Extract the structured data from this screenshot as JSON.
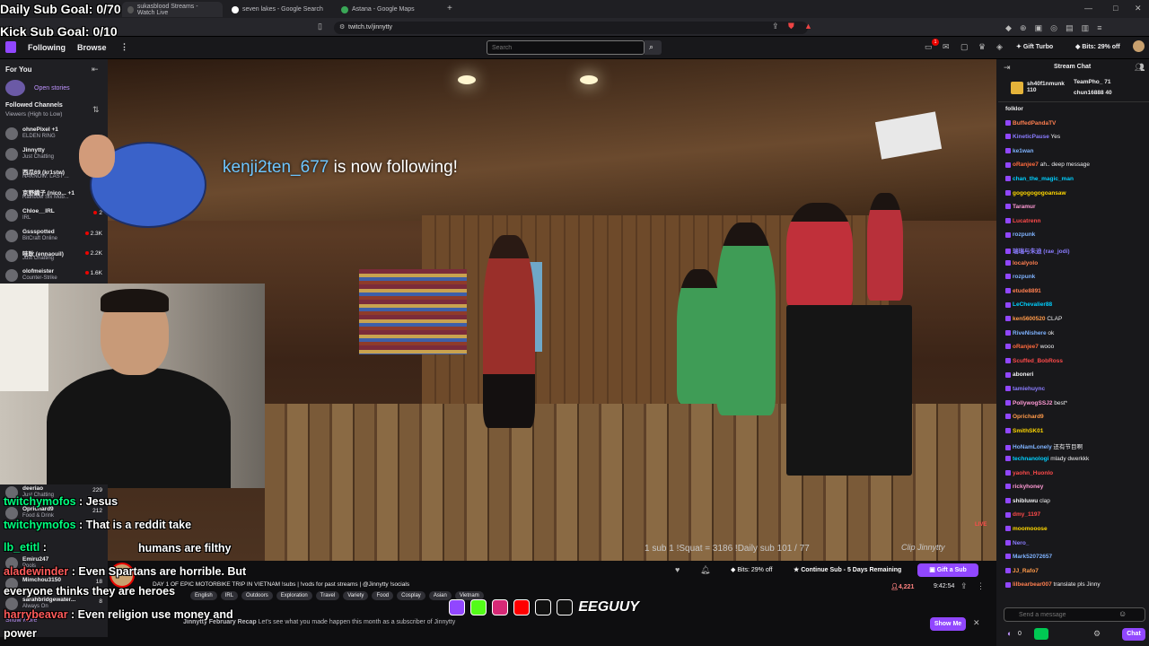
{
  "browser": {
    "tabs": [
      {
        "title": "sukasblood Streams - Watch Live"
      },
      {
        "title": "seven lakes - Google Search"
      },
      {
        "title": "Astana - Google Maps"
      }
    ],
    "new_tab": "+",
    "url": "twitch.tv/jinnytty"
  },
  "header": {
    "following": "Following",
    "browse": "Browse",
    "more": "⋮",
    "search_placeholder": "Search",
    "notif_count": "1",
    "get_turbo": "Gift Turbo",
    "bits": "Bits: 29% off"
  },
  "sidebar": {
    "for_you": "For You",
    "open_stories": "Open stories",
    "followed": "Followed Channels",
    "sort": "Viewers (High to Low)",
    "channels": [
      {
        "name": "ohnePixel +1",
        "game": "ELDEN RING",
        "viewers": ""
      },
      {
        "name": "Jinnytty",
        "game": "Just Chatting",
        "viewers": ""
      },
      {
        "name": "西瓜69 (kr1stw)",
        "game": "NAKNOW: LAST ...",
        "viewers": ""
      },
      {
        "name": "京野織子 (nico... +1",
        "game": "Rainbow Six Mob...",
        "viewers": ""
      },
      {
        "name": "Chloe__IRL",
        "game": "IRL",
        "viewers": "2"
      },
      {
        "name": "Gssspotted",
        "game": "BitCraft Online",
        "viewers": "2.3K"
      },
      {
        "name": "哇耿 (ennaouil)",
        "game": "Just Chatting",
        "viewers": "2.2K"
      },
      {
        "name": "olofmeister",
        "game": "Counter-Strike",
        "viewers": "1.6K"
      }
    ],
    "lower_channels": [
      {
        "name": "deeriao",
        "game": "Just Chatting",
        "viewers": "229"
      },
      {
        "name": "Oprichard9",
        "game": "Food & Drink",
        "viewers": "212"
      },
      {
        "name": "Emiru247",
        "game": "Pools",
        "viewers": ""
      },
      {
        "name": "Mimchou3150",
        "game": "",
        "viewers": "18"
      },
      {
        "name": "sarahbridgewater...",
        "game": "Always On",
        "viewers": "8"
      }
    ],
    "show_more": "Show More"
  },
  "overlay": {
    "goal1": "Daily Sub Goal: 0/70",
    "goal2": "Kick Sub Goal: 0/10",
    "follow_user": "kenji2ten_677",
    "follow_text": " is now following!",
    "sub_stats": "1 sub 1 !Squat = 3186  !Daily sub 101 / 77",
    "clip_label": "Clip Jinnytty",
    "live": "LIVE",
    "chat": [
      {
        "user": "twitchymofos",
        "text": " : Jesus"
      },
      {
        "user": "twitchymofos",
        "text": " : That is a reddit take"
      },
      {
        "user": "lb_etitl",
        "text": " : "
      },
      {
        "user": "",
        "text": "humans are filthy"
      },
      {
        "user": "aladewinder",
        "text": " : Even Spartans are horrible. But"
      },
      {
        "user": "",
        "text": "everyone thinks they are heroes"
      },
      {
        "user": "harrybeavar",
        "text": " : Even religion use money and"
      },
      {
        "user": "",
        "text": "power"
      }
    ]
  },
  "stream": {
    "title": "DAY 1 OF EPIC MOTORBIKE TRIP IN VIETNAM !subs | !vods for past streams | @Jinnytty !socials",
    "tags": [
      "English",
      "IRL",
      "Outdoors",
      "Exploration",
      "Travel",
      "Variety",
      "Food",
      "Cosplay",
      "Asian",
      "Vietnam"
    ],
    "viewers": "4,221",
    "uptime": "9:42:54",
    "bits_offer": "Bits: 29% off",
    "continue_sub": "Continue Sub - 5 Days Remaining",
    "gift_sub": "Gift a Sub",
    "recap_title": "Jinnytty February Recap",
    "recap_text": "Let's see what you made happen this month as a subscriber of Jinnytty",
    "show_me": "Show Me",
    "socials_logo": "EEGUUY"
  },
  "chat": {
    "title": "Stream Chat",
    "gifters": [
      {
        "name": "sh40f1nmunk",
        "count": "110"
      },
      {
        "name": "TeamPho_",
        "count": "71"
      },
      {
        "name": "chun16888",
        "count": "40"
      }
    ],
    "messages": [
      {
        "user": "folklor",
        "text": "",
        "color": "#efeff1"
      },
      {
        "user": "BuffedPandaTV",
        "text": "",
        "color": "#ff7f50"
      },
      {
        "user": "KineticPause",
        "text": " Yes",
        "color": "#8a7cff"
      },
      {
        "user": "ke1wan",
        "text": "",
        "color": "#7fb3ff"
      },
      {
        "user": "oRanjee7",
        "text": " ah.. deep message",
        "color": "#ff6a3d"
      },
      {
        "user": "chan_the_magic_man",
        "text": "",
        "color": "#00d0ff"
      },
      {
        "user": "gogogogogoansaw",
        "text": "",
        "color": "#ffd700"
      },
      {
        "user": "Taramur",
        "text": "",
        "color": "#ff9ad5"
      },
      {
        "user": "Lucatrenn",
        "text": "",
        "color": "#ff4a4a"
      },
      {
        "user": "rozpunk",
        "text": "",
        "color": "#7fb3ff"
      },
      {
        "user": "瑞瑞与朱迪 (rae_jodi)",
        "text": "",
        "color": "#8a7cff"
      },
      {
        "user": "localyolo",
        "text": "",
        "color": "#ff7f50"
      },
      {
        "user": "rozpunk",
        "text": "",
        "color": "#7fb3ff"
      },
      {
        "user": "etude8891",
        "text": "",
        "color": "#ff7f50"
      },
      {
        "user": "LeChevalier88",
        "text": "",
        "color": "#00d0ff"
      },
      {
        "user": "ken5600520",
        "text": " CLAP",
        "color": "#ff9a4a"
      },
      {
        "user": "RiveNishere",
        "text": " ok",
        "color": "#7fb3ff"
      },
      {
        "user": "oRanjee7",
        "text": " wooo",
        "color": "#ff6a3d"
      },
      {
        "user": "Scuffed_BobRoss",
        "text": "",
        "color": "#ff4a4a"
      },
      {
        "user": "aboneri",
        "text": "",
        "color": "#efeff1"
      },
      {
        "user": "tamiehuync",
        "text": "",
        "color": "#8a7cff"
      },
      {
        "user": "PollywogSSJ2",
        "text": " best*",
        "color": "#ff9ad5"
      },
      {
        "user": "Oprichard9",
        "text": "",
        "color": "#ff9a4a"
      },
      {
        "user": "SmithSK01",
        "text": "",
        "color": "#ffd700"
      },
      {
        "user": "HoNamLonely",
        "text": " 还有节目啊",
        "color": "#7fb3ff"
      },
      {
        "user": "technanologi",
        "text": " mlady dwerkkk",
        "color": "#00d0ff"
      },
      {
        "user": "yaohn_Huonlo",
        "text": "",
        "color": "#ff4a4a"
      },
      {
        "user": "rickyhoney",
        "text": "",
        "color": "#ff9ad5"
      },
      {
        "user": "shibluwu",
        "text": " clap",
        "color": "#efeff1"
      },
      {
        "user": "dmy_1197",
        "text": "",
        "color": "#ff4a4a"
      },
      {
        "user": "moomooose",
        "text": "",
        "color": "#ffd700"
      },
      {
        "user": "Nero_",
        "text": "",
        "color": "#8a7cff"
      },
      {
        "user": "Mark52072657",
        "text": "",
        "color": "#7fb3ff"
      },
      {
        "user": "JJ_Rafo7",
        "text": "",
        "color": "#ff9a4a"
      },
      {
        "user": "lilbearbear007",
        "text": " translate pls Jinny",
        "color": "#ff7f50"
      }
    ],
    "input_placeholder": "Send a message",
    "points": "0",
    "chat_button": "Chat"
  }
}
